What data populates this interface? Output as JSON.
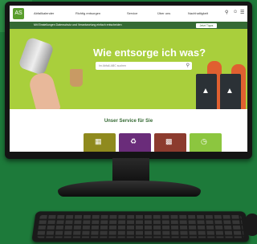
{
  "nav": {
    "logo_label": "AS",
    "items": [
      "Abfallkalender",
      "Richtig entsorgen",
      "Service",
      "Über uns",
      "Nachhaltigkeit"
    ],
    "icons": [
      "search-icon",
      "user-icon",
      "menu-icon"
    ]
  },
  "notice": {
    "text": "Mit Einstellungen Datenschutz und Verantwortung einfach entscheiden",
    "button": "Jetzt Tipps"
  },
  "hero": {
    "title": "Wie entsorge ich was?",
    "search_placeholder": "Im Abfall-ABC suchen"
  },
  "service": {
    "title": "Unser Service für Sie",
    "tiles": [
      {
        "color": "#8f8a1e",
        "icon": "calendar-icon"
      },
      {
        "color": "#6a2c7a",
        "icon": "recycling-icon"
      },
      {
        "color": "#8c3b2e",
        "icon": "truck-icon"
      },
      {
        "color": "#8cc63f",
        "icon": "clock-icon"
      }
    ]
  },
  "colors": {
    "brand_green": "#5a9e2e",
    "hero_green": "#a9cf3c",
    "dark_green": "#356a34",
    "background": "#1d7a3a"
  }
}
